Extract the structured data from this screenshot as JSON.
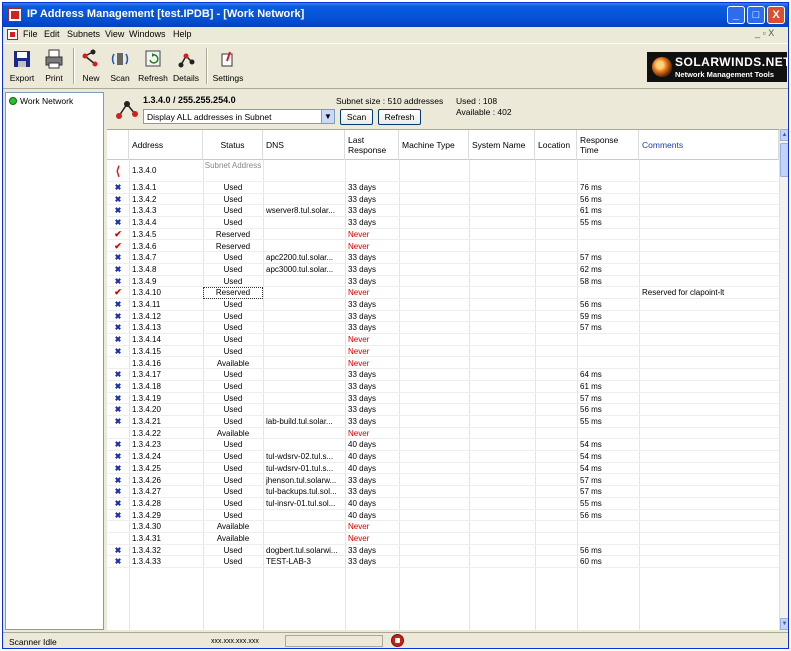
{
  "window": {
    "title": "IP Address Management [test.IPDB] - [Work Network]",
    "controls": [
      "_",
      "□",
      "X"
    ]
  },
  "menu": {
    "items": [
      "File",
      "Edit",
      "Subnets",
      "View",
      "Windows",
      "Help"
    ],
    "mdi_controls": "_ ▫ X"
  },
  "toolbar": {
    "export": "Export",
    "print": "Print",
    "new": "New",
    "scan": "Scan",
    "refresh": "Refresh",
    "details": "Details",
    "settings": "Settings"
  },
  "logo": {
    "name": "SOLARWINDS.NET",
    "tagline": "Network Management Tools"
  },
  "tree": {
    "item": "Work Network",
    "status_color": "#29c229"
  },
  "subnet": {
    "title": "1.3.4.0 / 255.255.254.0",
    "filter": "Display ALL addresses in Subnet",
    "scan_button": "Scan",
    "refresh_button": "Refresh",
    "size": "Subnet size : 510 addresses",
    "used": "Used : 108",
    "available": "Available : 402"
  },
  "table": {
    "headers": [
      "Address",
      "Status",
      "DNS",
      "Last Response",
      "Machine Type",
      "System Name",
      "Location",
      "Response Time",
      "Comments"
    ],
    "rows": [
      {
        "icon": "subnet",
        "address": "1.3.4.0",
        "status": "Subnet Address",
        "dns": "",
        "last": "",
        "rt": "",
        "comment": ""
      },
      {
        "icon": "x",
        "address": "1.3.4.1",
        "status": "Used",
        "dns": "",
        "last": "33 days",
        "rt": "76 ms",
        "comment": ""
      },
      {
        "icon": "x",
        "address": "1.3.4.2",
        "status": "Used",
        "dns": "",
        "last": "33 days",
        "rt": "56 ms",
        "comment": ""
      },
      {
        "icon": "x",
        "address": "1.3.4.3",
        "status": "Used",
        "dns": "wserver8.tul.solar...",
        "last": "33 days",
        "rt": "61 ms",
        "comment": ""
      },
      {
        "icon": "x",
        "address": "1.3.4.4",
        "status": "Used",
        "dns": "",
        "last": "33 days",
        "rt": "55 ms",
        "comment": ""
      },
      {
        "icon": "check",
        "address": "1.3.4.5",
        "status": "Reserved",
        "dns": "",
        "last": "Never",
        "rt": "",
        "comment": ""
      },
      {
        "icon": "check",
        "address": "1.3.4.6",
        "status": "Reserved",
        "dns": "",
        "last": "Never",
        "rt": "",
        "comment": ""
      },
      {
        "icon": "x",
        "address": "1.3.4.7",
        "status": "Used",
        "dns": "apc2200.tul.solar...",
        "last": "33 days",
        "rt": "57 ms",
        "comment": ""
      },
      {
        "icon": "x",
        "address": "1.3.4.8",
        "status": "Used",
        "dns": "apc3000.tul.solar...",
        "last": "33 days",
        "rt": "62 ms",
        "comment": ""
      },
      {
        "icon": "x",
        "address": "1.3.4.9",
        "status": "Used",
        "dns": "",
        "last": "33 days",
        "rt": "58 ms",
        "comment": ""
      },
      {
        "icon": "check",
        "address": "1.3.4.10",
        "status": "Reserved",
        "dns": "",
        "last": "Never",
        "rt": "",
        "comment": "Reserved for clapoint-lt"
      },
      {
        "icon": "x",
        "address": "1.3.4.11",
        "status": "Used",
        "dns": "",
        "last": "33 days",
        "rt": "56 ms",
        "comment": ""
      },
      {
        "icon": "x",
        "address": "1.3.4.12",
        "status": "Used",
        "dns": "",
        "last": "33 days",
        "rt": "59 ms",
        "comment": ""
      },
      {
        "icon": "x",
        "address": "1.3.4.13",
        "status": "Used",
        "dns": "",
        "last": "33 days",
        "rt": "57 ms",
        "comment": ""
      },
      {
        "icon": "x",
        "address": "1.3.4.14",
        "status": "Used",
        "dns": "",
        "last": "Never",
        "rt": "",
        "comment": ""
      },
      {
        "icon": "x",
        "address": "1.3.4.15",
        "status": "Used",
        "dns": "",
        "last": "Never",
        "rt": "",
        "comment": ""
      },
      {
        "icon": "",
        "address": "1.3.4.16",
        "status": "Available",
        "dns": "",
        "last": "Never",
        "rt": "",
        "comment": ""
      },
      {
        "icon": "x",
        "address": "1.3.4.17",
        "status": "Used",
        "dns": "",
        "last": "33 days",
        "rt": "64 ms",
        "comment": ""
      },
      {
        "icon": "x",
        "address": "1.3.4.18",
        "status": "Used",
        "dns": "",
        "last": "33 days",
        "rt": "61 ms",
        "comment": ""
      },
      {
        "icon": "x",
        "address": "1.3.4.19",
        "status": "Used",
        "dns": "",
        "last": "33 days",
        "rt": "57 ms",
        "comment": ""
      },
      {
        "icon": "x",
        "address": "1.3.4.20",
        "status": "Used",
        "dns": "",
        "last": "33 days",
        "rt": "56 ms",
        "comment": ""
      },
      {
        "icon": "x",
        "address": "1.3.4.21",
        "status": "Used",
        "dns": "lab-build.tul.solar...",
        "last": "33 days",
        "rt": "55 ms",
        "comment": ""
      },
      {
        "icon": "",
        "address": "1.3.4.22",
        "status": "Available",
        "dns": "",
        "last": "Never",
        "rt": "",
        "comment": ""
      },
      {
        "icon": "x",
        "address": "1.3.4.23",
        "status": "Used",
        "dns": "",
        "last": "40 days",
        "rt": "54 ms",
        "comment": ""
      },
      {
        "icon": "x",
        "address": "1.3.4.24",
        "status": "Used",
        "dns": "tul-wdsrv-02.tul.s...",
        "last": "40 days",
        "rt": "54 ms",
        "comment": ""
      },
      {
        "icon": "x",
        "address": "1.3.4.25",
        "status": "Used",
        "dns": "tul-wdsrv-01.tul.s...",
        "last": "40 days",
        "rt": "54 ms",
        "comment": ""
      },
      {
        "icon": "x",
        "address": "1.3.4.26",
        "status": "Used",
        "dns": "jhenson.tul.solarw...",
        "last": "33 days",
        "rt": "57 ms",
        "comment": ""
      },
      {
        "icon": "x",
        "address": "1.3.4.27",
        "status": "Used",
        "dns": "tul-backups.tul.sol...",
        "last": "33 days",
        "rt": "57 ms",
        "comment": ""
      },
      {
        "icon": "x",
        "address": "1.3.4.28",
        "status": "Used",
        "dns": "tul-insrv-01.tul.sol...",
        "last": "40 days",
        "rt": "55 ms",
        "comment": ""
      },
      {
        "icon": "x",
        "address": "1.3.4.29",
        "status": "Used",
        "dns": "",
        "last": "40 days",
        "rt": "56 ms",
        "comment": ""
      },
      {
        "icon": "",
        "address": "1.3.4.30",
        "status": "Available",
        "dns": "",
        "last": "Never",
        "rt": "",
        "comment": ""
      },
      {
        "icon": "",
        "address": "1.3.4.31",
        "status": "Available",
        "dns": "",
        "last": "Never",
        "rt": "",
        "comment": ""
      },
      {
        "icon": "x",
        "address": "1.3.4.32",
        "status": "Used",
        "dns": "dogbert.tul.solarwi...",
        "last": "33 days",
        "rt": "56 ms",
        "comment": ""
      },
      {
        "icon": "x",
        "address": "1.3.4.33",
        "status": "Used",
        "dns": "TEST-LAB-3",
        "last": "33 days",
        "rt": "60 ms",
        "comment": ""
      }
    ]
  },
  "status": {
    "text": "Scanner Idle",
    "ip": "xxx.xxx.xxx.xxx"
  },
  "colors": {
    "titlebar": "#0553d7",
    "never": "#d40000",
    "used_icon": "#1c2fa8",
    "reserved_icon": "#d40000",
    "comments_header": "#1a3fa5"
  }
}
